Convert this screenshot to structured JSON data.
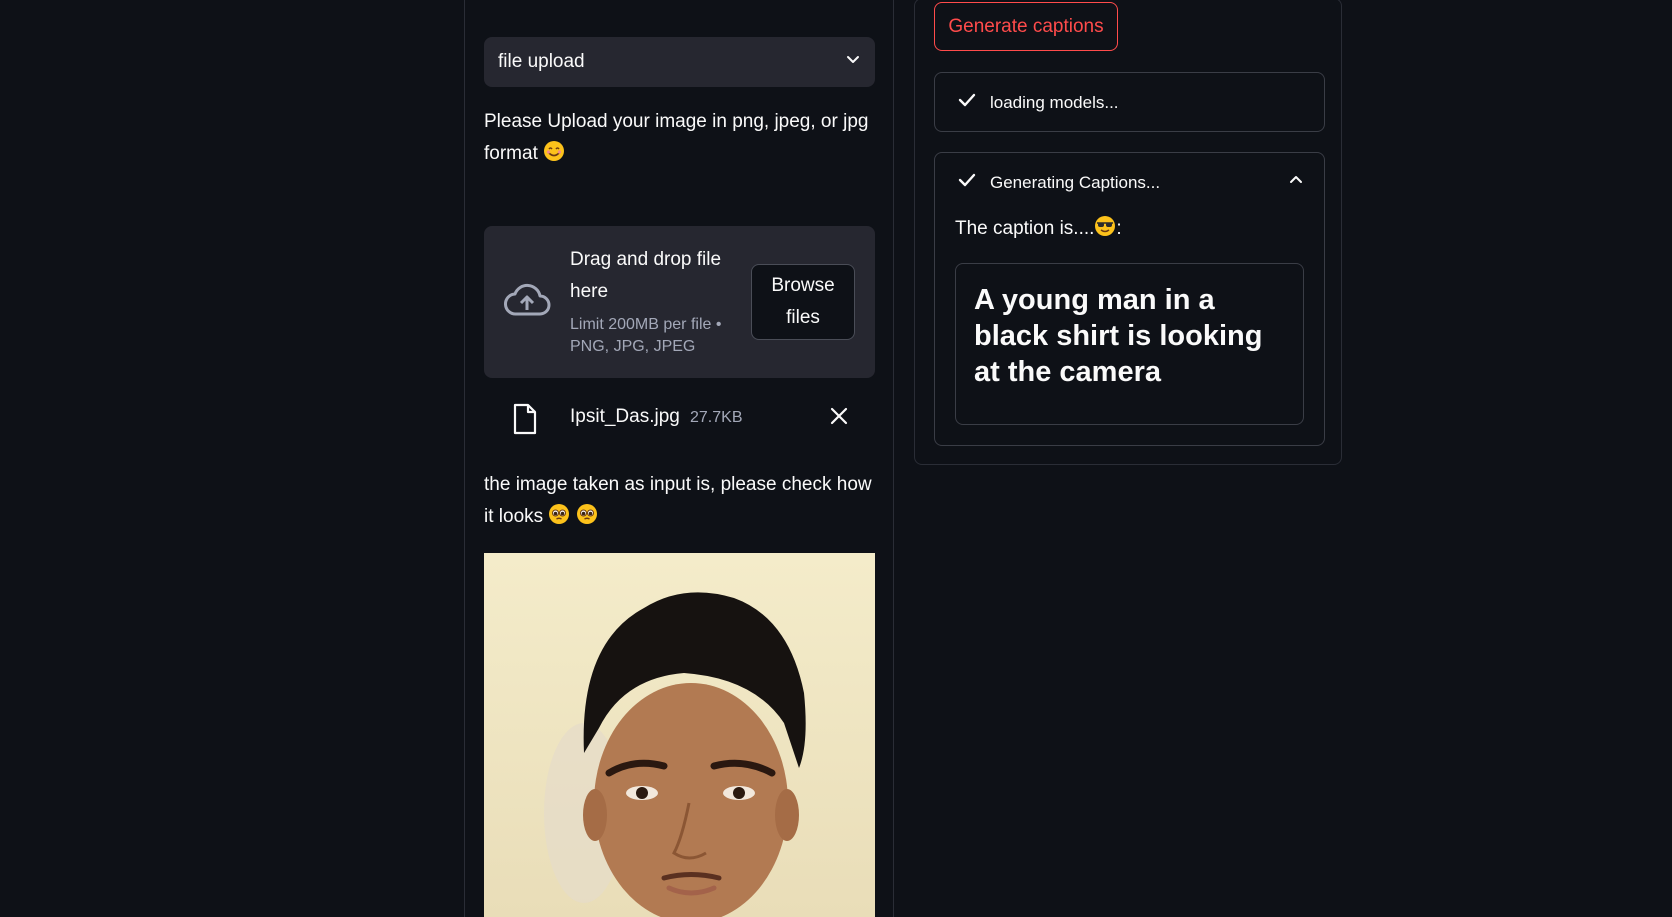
{
  "input_method": {
    "selected": "file upload"
  },
  "instructions": {
    "text": "Please Upload your image in png, jpeg, or jpg format",
    "emoji": "smiling-face-emoji"
  },
  "uploader": {
    "drag_text": "Drag and drop file here",
    "limit_text": "Limit 200MB per file • PNG, JPG, JPEG",
    "browse_label": "Browse files",
    "icon": "cloud-upload-icon"
  },
  "uploaded_file": {
    "name": "Ipsit_Das.jpg",
    "size": "27.7KB",
    "icon": "file-icon"
  },
  "preview": {
    "text": "the image taken as input is, please check how it looks",
    "emojis": [
      "pleading-face-emoji",
      "pleading-face-emoji"
    ]
  },
  "actions": {
    "generate_label": "Generate captions"
  },
  "status": {
    "loading_label": "loading models...",
    "generating_label": "Generating Captions..."
  },
  "caption": {
    "label": "The caption is....",
    "suffix": ":",
    "emoji": "sunglasses-face-emoji",
    "text": "A young man in a black shirt is looking at the camera"
  },
  "colors": {
    "background": "#0e1117",
    "widget_bg": "#262730",
    "accent_red": "#ff4b4b",
    "border": "#3a3d46"
  }
}
